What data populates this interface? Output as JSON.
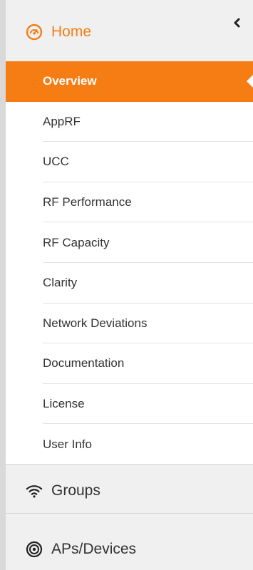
{
  "colors": {
    "accent": "#f57d14",
    "panel": "#f0f0f0",
    "submenu_bg": "#ffffff",
    "text": "#333333"
  },
  "sidebar": {
    "home": {
      "label": "Home",
      "icon": "dashboard-gauge-icon",
      "expanded": true,
      "items": [
        {
          "label": "Overview",
          "active": true
        },
        {
          "label": "AppRF"
        },
        {
          "label": "UCC"
        },
        {
          "label": "RF Performance"
        },
        {
          "label": "RF Capacity"
        },
        {
          "label": "Clarity"
        },
        {
          "label": "Network Deviations"
        },
        {
          "label": "Documentation"
        },
        {
          "label": "License"
        },
        {
          "label": "User Info"
        }
      ]
    },
    "groups": {
      "label": "Groups",
      "icon": "wifi-icon"
    },
    "aps": {
      "label": "APs/Devices",
      "icon": "access-point-icon"
    },
    "collapse_icon": "chevron-left-icon"
  }
}
